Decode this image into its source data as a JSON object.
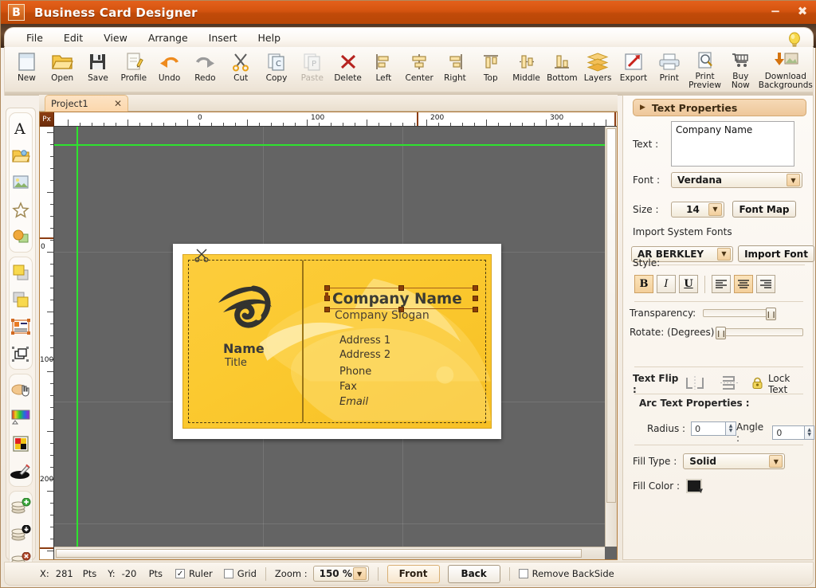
{
  "window": {
    "badge": "B",
    "title": "Business Card Designer",
    "minimize_icon": "minimize-icon",
    "close_icon": "close-icon",
    "tip_icon": "lightbulb-icon"
  },
  "menubar": {
    "items": [
      {
        "label": "File"
      },
      {
        "label": "Edit"
      },
      {
        "label": "View"
      },
      {
        "label": "Arrange"
      },
      {
        "label": "Insert"
      },
      {
        "label": "Help"
      }
    ]
  },
  "toolbar": {
    "buttons": [
      {
        "label": "New",
        "icon": "new-document-icon",
        "disabled": false
      },
      {
        "label": "Open",
        "icon": "open-folder-icon",
        "disabled": false
      },
      {
        "label": "Save",
        "icon": "floppy-disk-icon",
        "disabled": false
      },
      {
        "label": "Profile",
        "icon": "profile-pencil-icon",
        "disabled": false
      },
      {
        "label": "Undo",
        "icon": "undo-arrow-icon",
        "disabled": false
      },
      {
        "label": "Redo",
        "icon": "redo-arrow-icon",
        "disabled": false
      },
      {
        "label": "Cut",
        "icon": "scissors-icon",
        "disabled": false
      },
      {
        "label": "Copy",
        "icon": "copy-icon",
        "disabled": false
      },
      {
        "label": "Paste",
        "icon": "paste-icon",
        "disabled": true
      },
      {
        "label": "Delete",
        "icon": "delete-x-icon",
        "disabled": false
      },
      {
        "label": "Left",
        "icon": "align-left-icon",
        "disabled": false
      },
      {
        "label": "Center",
        "icon": "align-center-icon",
        "disabled": false
      },
      {
        "label": "Right",
        "icon": "align-right-icon",
        "disabled": false
      },
      {
        "label": "Top",
        "icon": "align-top-icon",
        "disabled": false
      },
      {
        "label": "Middle",
        "icon": "align-middle-icon",
        "disabled": false
      },
      {
        "label": "Bottom",
        "icon": "align-bottom-icon",
        "disabled": false
      },
      {
        "label": "Layers",
        "icon": "layers-icon",
        "disabled": false
      },
      {
        "label": "Export",
        "icon": "export-arrow-icon",
        "disabled": false
      },
      {
        "label": "Print",
        "icon": "printer-icon",
        "disabled": false
      },
      {
        "label": "Print\nPreview",
        "icon": "print-preview-icon",
        "disabled": false
      },
      {
        "label": "Buy\nNow",
        "icon": "shopping-cart-icon",
        "disabled": false
      },
      {
        "label": "Download\nBackgrounds",
        "icon": "download-backgrounds-icon",
        "disabled": false
      }
    ]
  },
  "left_rail": {
    "groups": [
      {
        "tools": [
          {
            "icon": "text-tool-icon"
          },
          {
            "icon": "open-image-folder-icon"
          },
          {
            "icon": "picture-icon"
          },
          {
            "icon": "shape-star-icon"
          },
          {
            "icon": "color-shapes-icon"
          }
        ]
      },
      {
        "tools": [
          {
            "icon": "bring-forward-icon"
          },
          {
            "icon": "send-backward-icon"
          },
          {
            "icon": "group-objects-icon"
          },
          {
            "icon": "ungroup-objects-icon"
          }
        ]
      },
      {
        "tools": [
          {
            "icon": "hand-pan-icon"
          },
          {
            "icon": "gradient-picker-icon"
          },
          {
            "icon": "palette-icon"
          },
          {
            "icon": "eyedropper-icon"
          }
        ]
      },
      {
        "tools": [
          {
            "icon": "add-layer-icon"
          },
          {
            "icon": "layer-down-icon"
          },
          {
            "icon": "delete-layer-icon"
          }
        ]
      }
    ]
  },
  "tabs": [
    {
      "label": "Project1",
      "close_icon": "close-tab-icon",
      "active": true
    }
  ],
  "ruler": {
    "unit": "Px",
    "horizontal_labels": [
      "0",
      "100",
      "200",
      "300"
    ],
    "vertical_labels": [
      "0",
      "100",
      "200"
    ]
  },
  "card": {
    "company_name": "Company Name",
    "company_slogan": "Company Slogan",
    "person_name": "Name",
    "person_title": "Title",
    "contact_lines": [
      "Address 1",
      "Address 2",
      "Phone",
      "Fax"
    ],
    "email_line": "Email",
    "logo_icon": "swirl-logo-icon",
    "scissors_icon": "cut-marker-scissors-icon",
    "background_color": "#fbc92f",
    "accent_color": "#9a7417"
  },
  "panel": {
    "header": "Text Properties",
    "expand_icon": "triangle-right-icon",
    "text_label": "Text :",
    "text_value": "Company Name",
    "font_label": "Font :",
    "font_value": "Verdana",
    "size_label": "Size :",
    "size_value": "14",
    "font_map_button": "Font Map",
    "import_system_fonts_label": "Import System Fonts",
    "import_font_value": "AR BERKLEY",
    "import_font_button": "Import Font",
    "style_label": "Style:",
    "style_buttons": [
      {
        "label": "B",
        "name": "bold-button",
        "active": true
      },
      {
        "label": "I",
        "name": "italic-button",
        "active": false
      },
      {
        "label": "U",
        "name": "underline-button",
        "active": false
      }
    ],
    "align_buttons": [
      {
        "name": "align-left-button",
        "active": false
      },
      {
        "name": "align-center-button",
        "active": true
      },
      {
        "name": "align-right-button",
        "active": false
      }
    ],
    "transparency_label": "Transparency:",
    "transparency_value": 100,
    "rotate_label": "Rotate: (Degrees)",
    "rotate_value": 0,
    "text_flip_label": "Text Flip :",
    "flip_horizontal_icon": "flip-horizontal-icon",
    "flip_vertical_icon": "flip-vertical-icon",
    "lock_icon": "padlock-icon",
    "lock_text_label": "Lock Text",
    "arc_text_label": "Arc Text Properties :",
    "radius_label": "Radius :",
    "radius_value": "0",
    "angle_label": "Angle :",
    "angle_value": "0",
    "fill_type_label": "Fill Type :",
    "fill_type_value": "Solid",
    "fill_color_label": "Fill Color :",
    "fill_color_value": "#1a1a1a"
  },
  "statusbar": {
    "x_label": "X:",
    "x_value": "281",
    "x_unit": "Pts",
    "y_label": "Y:",
    "y_value": "-20",
    "y_unit": "Pts",
    "ruler_label": "Ruler",
    "ruler_checked": true,
    "grid_label": "Grid",
    "grid_checked": false,
    "zoom_label": "Zoom :",
    "zoom_value": "150 %",
    "front_button": "Front",
    "back_button": "Back",
    "remove_backside_label": "Remove BackSide",
    "remove_backside_checked": false
  }
}
